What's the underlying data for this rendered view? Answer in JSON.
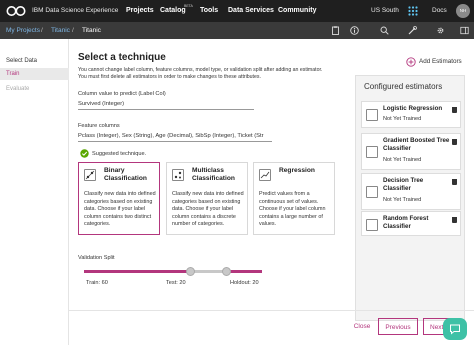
{
  "topbar": {
    "brand": "IBM Data Science Experience",
    "nav": [
      "Projects",
      "Catalog",
      "Tools",
      "Data Services",
      "Community"
    ],
    "catalog_badge": "BETA",
    "region": "US South",
    "docs": "Docs",
    "avatar_initials": "NH"
  },
  "breadcrumb": [
    "My Projects",
    "Titanic",
    "Titanic"
  ],
  "sidebar": {
    "items": [
      "Select Data",
      "Train",
      "Evaluate"
    ]
  },
  "main": {
    "title": "Select a technique",
    "notice_line1": "You cannot change label column, feature columns, model type, or validation split after adding an estimator.",
    "notice_line2": "You must first delete all estimators in order to make changes to these attributes.",
    "label_col_caption": "Column value to predict (Label Col)",
    "label_col_value": "Survived (Integer)",
    "feature_caption": "Feature columns",
    "feature_value": "Pclass (Integer), Sex (String), Age (Decimal), SibSp (Integer), Ticket (Str",
    "suggested": "Suggested technique.",
    "techniques": [
      {
        "title_l1": "Binary",
        "title_l2": "Classification",
        "desc": [
          "Classify new data into defined",
          "categories based on existing",
          "data. Choose if your label",
          "column contains two distinct",
          "categories."
        ]
      },
      {
        "title_l1": "Multiclass",
        "title_l2": "Classification",
        "desc": [
          "Classify new data into defined",
          "categories based on existing",
          "data. Choose if your label",
          "column contains a discrete",
          "number of categories."
        ]
      },
      {
        "title_l1": "Regression",
        "title_l2": "",
        "desc": [
          "Predict values from a",
          "continuous set of values.",
          "Choose if your label column",
          "contains a large number of",
          "values."
        ]
      }
    ],
    "split_caption": "Validation Split",
    "split": {
      "train": "Train: 60",
      "test": "Test: 20",
      "holdout": "Holdout: 20"
    }
  },
  "estimators": {
    "add_label": "Add Estimators",
    "title": "Configured estimators",
    "items": [
      {
        "name_l1": "Logistic Regression",
        "name_l2": "",
        "status": "Not Yet Trained"
      },
      {
        "name_l1": "Gradient Boosted Tree",
        "name_l2": "Classifier",
        "status": "Not Yet Trained"
      },
      {
        "name_l1": "Decision Tree",
        "name_l2": "Classifier",
        "status": "Not Yet Trained"
      },
      {
        "name_l1": "Random Forest",
        "name_l2": "Classifier",
        "status": ""
      }
    ]
  },
  "footer": {
    "close": "Close",
    "previous": "Previous",
    "next": "Next"
  },
  "colors": {
    "accent": "#b3367d",
    "topbar": "#1f1f1f",
    "subbar": "#3a3a3a",
    "suggest": "#5aa700",
    "chat": "#3ec1a6"
  }
}
